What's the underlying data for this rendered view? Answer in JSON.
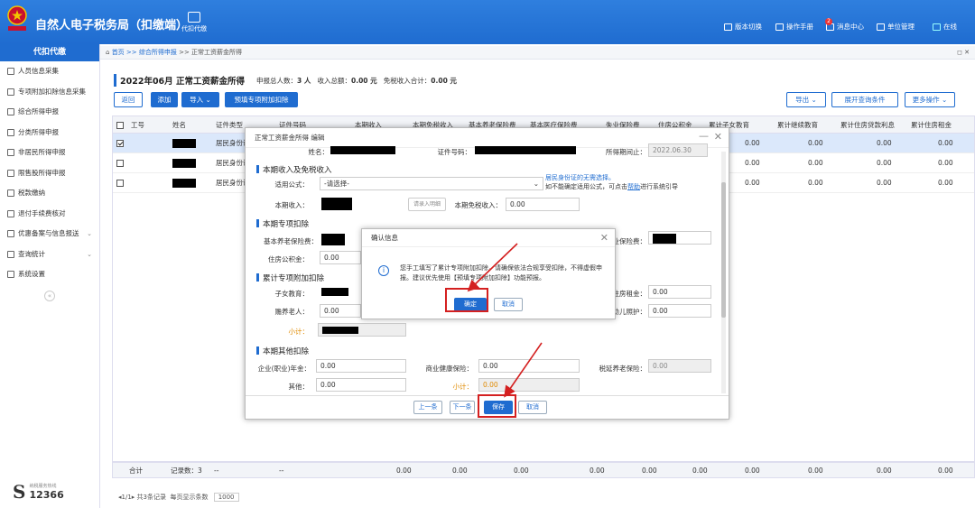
{
  "app": {
    "title": "自然人电子税务局（扣缴端）",
    "top_nav": "代扣代缴",
    "right_menu": [
      {
        "label": "版本切换",
        "icon": "switch-icon"
      },
      {
        "label": "操作手册",
        "icon": "book-icon"
      },
      {
        "label": "消息中心",
        "icon": "message-icon",
        "badge": "2"
      },
      {
        "label": "单位管理",
        "icon": "building-icon"
      },
      {
        "label": "在线",
        "icon": "online-icon"
      }
    ]
  },
  "sidebar": {
    "title": "代扣代缴",
    "items": [
      {
        "label": "人员信息采集",
        "icon": "person-icon"
      },
      {
        "label": "专项附加扣除信息采集",
        "icon": "list-icon"
      },
      {
        "label": "综合所得申报",
        "icon": "file-icon"
      },
      {
        "label": "分类所得申报",
        "icon": "file-icon"
      },
      {
        "label": "非居民所得申报",
        "icon": "person-icon"
      },
      {
        "label": "限售股所得申报",
        "icon": "stock-icon"
      },
      {
        "label": "税款缴纳",
        "icon": "payment-icon"
      },
      {
        "label": "退付手续费核对",
        "icon": "doc-icon"
      },
      {
        "label": "优惠备案与信息报送",
        "icon": "box-icon",
        "chevron": "⌄"
      },
      {
        "label": "查询统计",
        "icon": "search-icon",
        "chevron": "⌄"
      },
      {
        "label": "系统设置",
        "icon": "gear-icon"
      }
    ],
    "hotline_label": "纳税服务热线",
    "hotline_number": "12366"
  },
  "breadcrumb": {
    "home": "首页",
    "parts": [
      " >> 综合所得申报",
      " >> 正常工资薪金所得"
    ],
    "controls": "◻ ✕"
  },
  "page": {
    "title": "2022年06月 正常工资薪金所得",
    "stats": [
      {
        "label": "申报总人数：",
        "value": "3 人"
      },
      {
        "label": "收入总额：",
        "value": "0.00 元"
      },
      {
        "label": "免税收入合计：",
        "value": "0.00 元"
      }
    ]
  },
  "toolbar": {
    "back": "返回",
    "add": "添加",
    "import": "导入",
    "prefill": "预填专项附加扣除",
    "export": "导出",
    "expand": "展开查询条件",
    "more": "更多操作"
  },
  "table": {
    "headers": [
      "工号",
      "姓名",
      "证件类型",
      "证件号码",
      "本期收入",
      "本期免税收入",
      "基本养老保险费",
      "基本医疗保险费",
      "失业保险费",
      "住房公积金",
      "累计子女教育",
      "累计继续教育",
      "累计住房贷款利息",
      "累计住房租金"
    ],
    "rows": [
      {
        "checked": true,
        "id_type": "居民身份证",
        "vals": [
          "0.00",
          "0.00",
          "0.00",
          "0.00"
        ]
      },
      {
        "checked": false,
        "id_type": "居民身份证",
        "vals": [
          "0.00",
          "0.00",
          "0.00",
          "0.00"
        ]
      },
      {
        "checked": false,
        "id_type": "居民身份证",
        "vals": [
          "0.00",
          "0.00",
          "0.00",
          "0.00"
        ]
      }
    ],
    "footer": {
      "label": "合计",
      "count": "记录数：3",
      "dash1": "--",
      "dash2": "--",
      "vals": [
        "0.00",
        "0.00",
        "0.00",
        "0.00",
        "0.00",
        "0.00",
        "0.00",
        "0.00",
        "0.00",
        "0.00"
      ]
    }
  },
  "pager": {
    "page": "1/1",
    "total": "共3条记录",
    "per_page_label": "每页显示条数",
    "per_page": "1000"
  },
  "dialog": {
    "title": "正常工资薪金所得 编辑",
    "top_fields": {
      "name_label": "姓名：",
      "id_label": "证件号码：",
      "date_label": "所得期间止：",
      "date_value": "2022.06.30"
    },
    "sec_income": "本期收入及免税收入",
    "formula_label": "适用公式：",
    "formula_value": "-请选择-",
    "link_text": "居民身份证的无需选择。",
    "hint_text": "如不能确定适用公式，可点击",
    "hint_link": "帮助",
    "hint_tail": "进行系统引导",
    "income_label": "本期收入：",
    "income_btn": "请录入明细",
    "taxfree_label": "本期免税收入：",
    "taxfree_value": "0.00",
    "sec_special": "本期专项扣除",
    "pension_label": "基本养老保险费：",
    "unemp_label": "失业保险费：",
    "fund_label": "住房公积金：",
    "fund_value": "0.00",
    "sec_cumulative": "累计专项附加扣除",
    "child_label": "子女教育：",
    "elder_label": "赡养老人：",
    "elder_value": "0.00",
    "rent_label": "住房租金：",
    "rent_value": "0.00",
    "infant_label": "婴幼儿照护：",
    "infant_value": "0.00",
    "subtotal_label": "小计：",
    "sec_other": "本期其他扣除",
    "annuity_label": "企业(职业)年金：",
    "annuity_value": "0.00",
    "health_label": "商业健康保险：",
    "health_value": "0.00",
    "deferred_label": "税延养老保险：",
    "deferred_value": "0.00",
    "other_label": "其他：",
    "other_value": "0.00",
    "subtotal2_label": "小计：",
    "subtotal2_value": "0.00",
    "buttons": {
      "prev": "上一条",
      "next": "下一条",
      "save": "保存",
      "cancel": "取消"
    }
  },
  "confirm": {
    "title": "确认信息",
    "message": "您手工填写了累计专项附加扣除，请确保依法合规享受扣除，不得虚假申报。建议优先使用【预填专项附加扣除】功能预报。",
    "ok": "确定",
    "cancel": "取消"
  },
  "colors": {
    "brand": "#1f6cd0",
    "highlight": "#d42020"
  }
}
